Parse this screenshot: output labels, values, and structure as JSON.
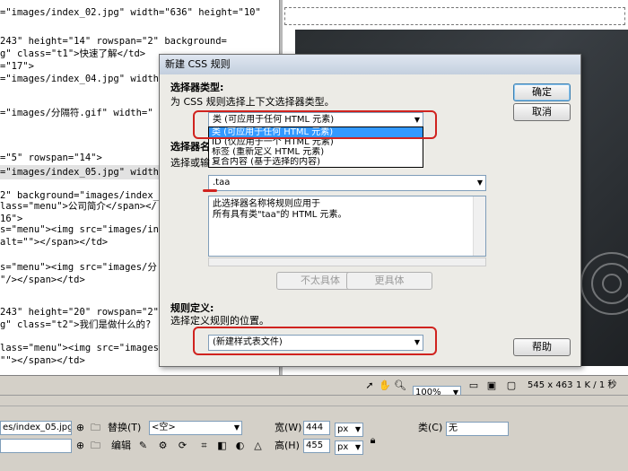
{
  "code_lines": [
    "=\"images/index_02.jpg\" width=\"636\" height=\"10\"",
    "",
    "243\" height=\"14\" rowspan=\"2\" background=",
    "g\" class=\"t1\">快速了解</td>",
    "=\"17\">",
    "=\"images/index_04.jpg\" width4",
    "",
    "",
    "=\"images/分隔符.gif\" width=\"",
    "",
    "",
    "=\"5\" rowspan=\"14\">",
    "=\"images/index_05.jpg\" width",
    "",
    "2\" background=\"images/index_0",
    "lass=\"menu\">公司简介</span></",
    "16\">",
    "s=\"menu\"><img src=\"images/in",
    "alt=\"\"></span></td>",
    "",
    "s=\"menu\"><img src=\"images/分",
    "\"/></span></td>",
    "",
    "",
    "243\" height=\"20\" rowspan=\"2\" b",
    "g\" class=\"t2\">我们是做什么的?",
    "",
    "lass=\"menu\"><img src=\"images/",
    "\"\"></span></td>"
  ],
  "dialog": {
    "title": "新建 CSS 规则",
    "selector_type_heading": "选择器类型:",
    "selector_type_desc": "为 CSS 规则选择上下文选择器类型。",
    "selector_type_value": "类 (可应用于任何 HTML 元素)",
    "dropdown_options": [
      "类 (可应用于任何 HTML 元素)",
      "ID (仅应用于一个 HTML 元素)",
      "标签 (重新定义 HTML 元素)",
      "复合内容 (基于选择的内容)"
    ],
    "selector_name_heading": "选择器名",
    "selector_name_desc": "选择或输",
    "selector_name_value": ".taa",
    "description_line1": "此选择器名称将规则应用于",
    "description_line2": "所有具有类\"taa\"的 HTML 元素。",
    "less_specific": "不太具体",
    "more_specific": "更具体",
    "rule_def_heading": "规则定义:",
    "rule_def_desc": "选择定义规则的位置。",
    "rule_def_value": "(新建样式表文件)",
    "ok": "确定",
    "cancel": "取消",
    "help": "帮助"
  },
  "statusbar": {
    "zoom": "100%",
    "size": "545 x 463",
    "speed": "1 K / 1 秒"
  },
  "properties": {
    "src_value": "es/index_05.jpg",
    "replace_label": "替换(T)",
    "replace_value": "<空>",
    "width_label": "宽(W)",
    "width_value": "444",
    "height_label": "高(H)",
    "height_value": "455",
    "unit": "px",
    "class_label": "类(C)",
    "class_value": "无",
    "edit_label": "编辑"
  }
}
